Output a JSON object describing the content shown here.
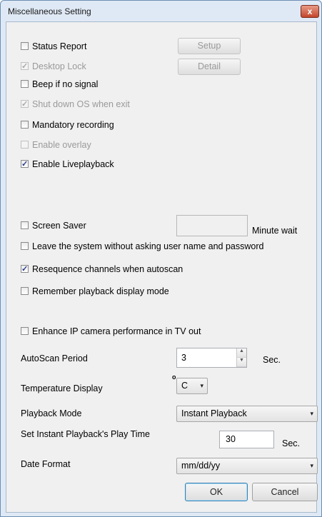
{
  "window": {
    "title": "Miscellaneous Setting",
    "close_symbol": "x"
  },
  "checkboxes": {
    "status_report": {
      "label": "Status Report",
      "checked": false,
      "enabled": true
    },
    "desktop_lock": {
      "label": "Desktop Lock",
      "checked": true,
      "enabled": false
    },
    "beep_no_signal": {
      "label": "Beep if no signal",
      "checked": false,
      "enabled": true
    },
    "shutdown_os": {
      "label": "Shut down OS when exit",
      "checked": true,
      "enabled": false
    },
    "mandatory_recording": {
      "label": "Mandatory recording",
      "checked": false,
      "enabled": true
    },
    "enable_overlay": {
      "label": "Enable overlay",
      "checked": false,
      "enabled": false
    },
    "enable_liveplayback": {
      "label": "Enable Liveplayback",
      "checked": true,
      "enabled": true
    },
    "screen_saver": {
      "label": "Screen Saver",
      "checked": false,
      "enabled": true
    },
    "leave_system": {
      "label": "Leave the system without asking user name and password",
      "checked": false,
      "enabled": true
    },
    "resequence": {
      "label": "Resequence channels when autoscan",
      "checked": true,
      "enabled": true
    },
    "remember_playback": {
      "label": "Remember playback display mode",
      "checked": false,
      "enabled": true
    },
    "enhance_ip": {
      "label": "Enhance IP camera performance in TV out",
      "checked": false,
      "enabled": true
    }
  },
  "buttons": {
    "setup": "Setup",
    "detail": "Detail",
    "ok": "OK",
    "cancel": "Cancel"
  },
  "screen_saver": {
    "minutes_value": "",
    "suffix": "Minute wait"
  },
  "autoscan": {
    "label": "AutoScan Period",
    "value": "3",
    "unit": "Sec."
  },
  "temperature": {
    "label": "Temperature Display",
    "degree": "o",
    "value": "C"
  },
  "playback_mode": {
    "label": "Playback Mode",
    "value": "Instant Playback"
  },
  "instant_playback": {
    "label": "Set Instant Playback's Play Time",
    "value": "30",
    "unit": "Sec."
  },
  "date_format": {
    "label": "Date Format",
    "value": "mm/dd/yy"
  },
  "icons": {
    "dropdown": "▾",
    "spin_up": "▲",
    "spin_down": "▼"
  }
}
